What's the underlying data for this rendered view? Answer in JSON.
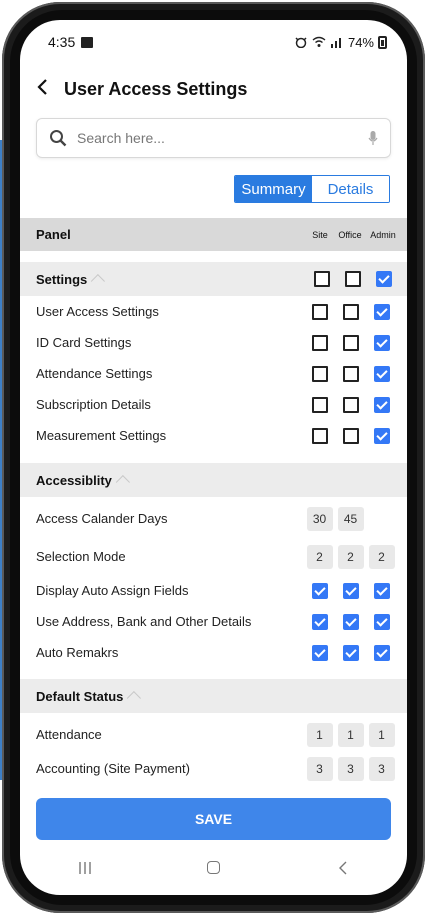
{
  "status_bar": {
    "time": "4:35",
    "battery": "74%"
  },
  "header": {
    "title": "User Access Settings"
  },
  "search": {
    "placeholder": "Search here..."
  },
  "view_toggle": {
    "summary": "Summary",
    "details": "Details",
    "active": "Summary"
  },
  "table": {
    "panel_label": "Panel",
    "columns": [
      "Site",
      "Office",
      "Admin"
    ]
  },
  "sections": {
    "settings": {
      "title": "Settings",
      "header_checks": [
        false,
        false,
        true
      ],
      "rows": [
        {
          "label": "User Access Settings",
          "checks": [
            false,
            false,
            true
          ]
        },
        {
          "label": "ID Card Settings",
          "checks": [
            false,
            false,
            true
          ]
        },
        {
          "label": "Attendance Settings",
          "checks": [
            false,
            false,
            true
          ]
        },
        {
          "label": "Subscription Details",
          "checks": [
            false,
            false,
            true
          ]
        },
        {
          "label": "Measurement Settings",
          "checks": [
            false,
            false,
            true
          ]
        }
      ]
    },
    "accessibility": {
      "title": "Accessiblity",
      "rows": [
        {
          "label": "Access Calander Days",
          "values": [
            "30",
            "45",
            ""
          ]
        },
        {
          "label": "Selection Mode",
          "values": [
            "2",
            "2",
            "2"
          ]
        },
        {
          "label": "Display Auto Assign Fields",
          "checks": [
            true,
            true,
            true
          ]
        },
        {
          "label": "Use Address, Bank and Other Details",
          "checks": [
            true,
            true,
            true
          ]
        },
        {
          "label": "Auto Remakrs",
          "checks": [
            true,
            true,
            true
          ]
        }
      ]
    },
    "default_status": {
      "title": "Default Status",
      "rows": [
        {
          "label": "Attendance",
          "values": [
            "1",
            "1",
            "1"
          ]
        },
        {
          "label": "Accounting (Site Payment)",
          "values": [
            "3",
            "3",
            "3"
          ]
        }
      ]
    }
  },
  "save_label": "SAVE",
  "colors": {
    "accent": "#2a7be0",
    "checkbox_on": "#3478f6",
    "save": "#3f86ea",
    "side_bar": "#3d7fc6"
  },
  "icons": {
    "back": "chevron-left-icon",
    "search": "search-icon",
    "mic": "mic-icon",
    "caret": "caret-up-icon"
  }
}
